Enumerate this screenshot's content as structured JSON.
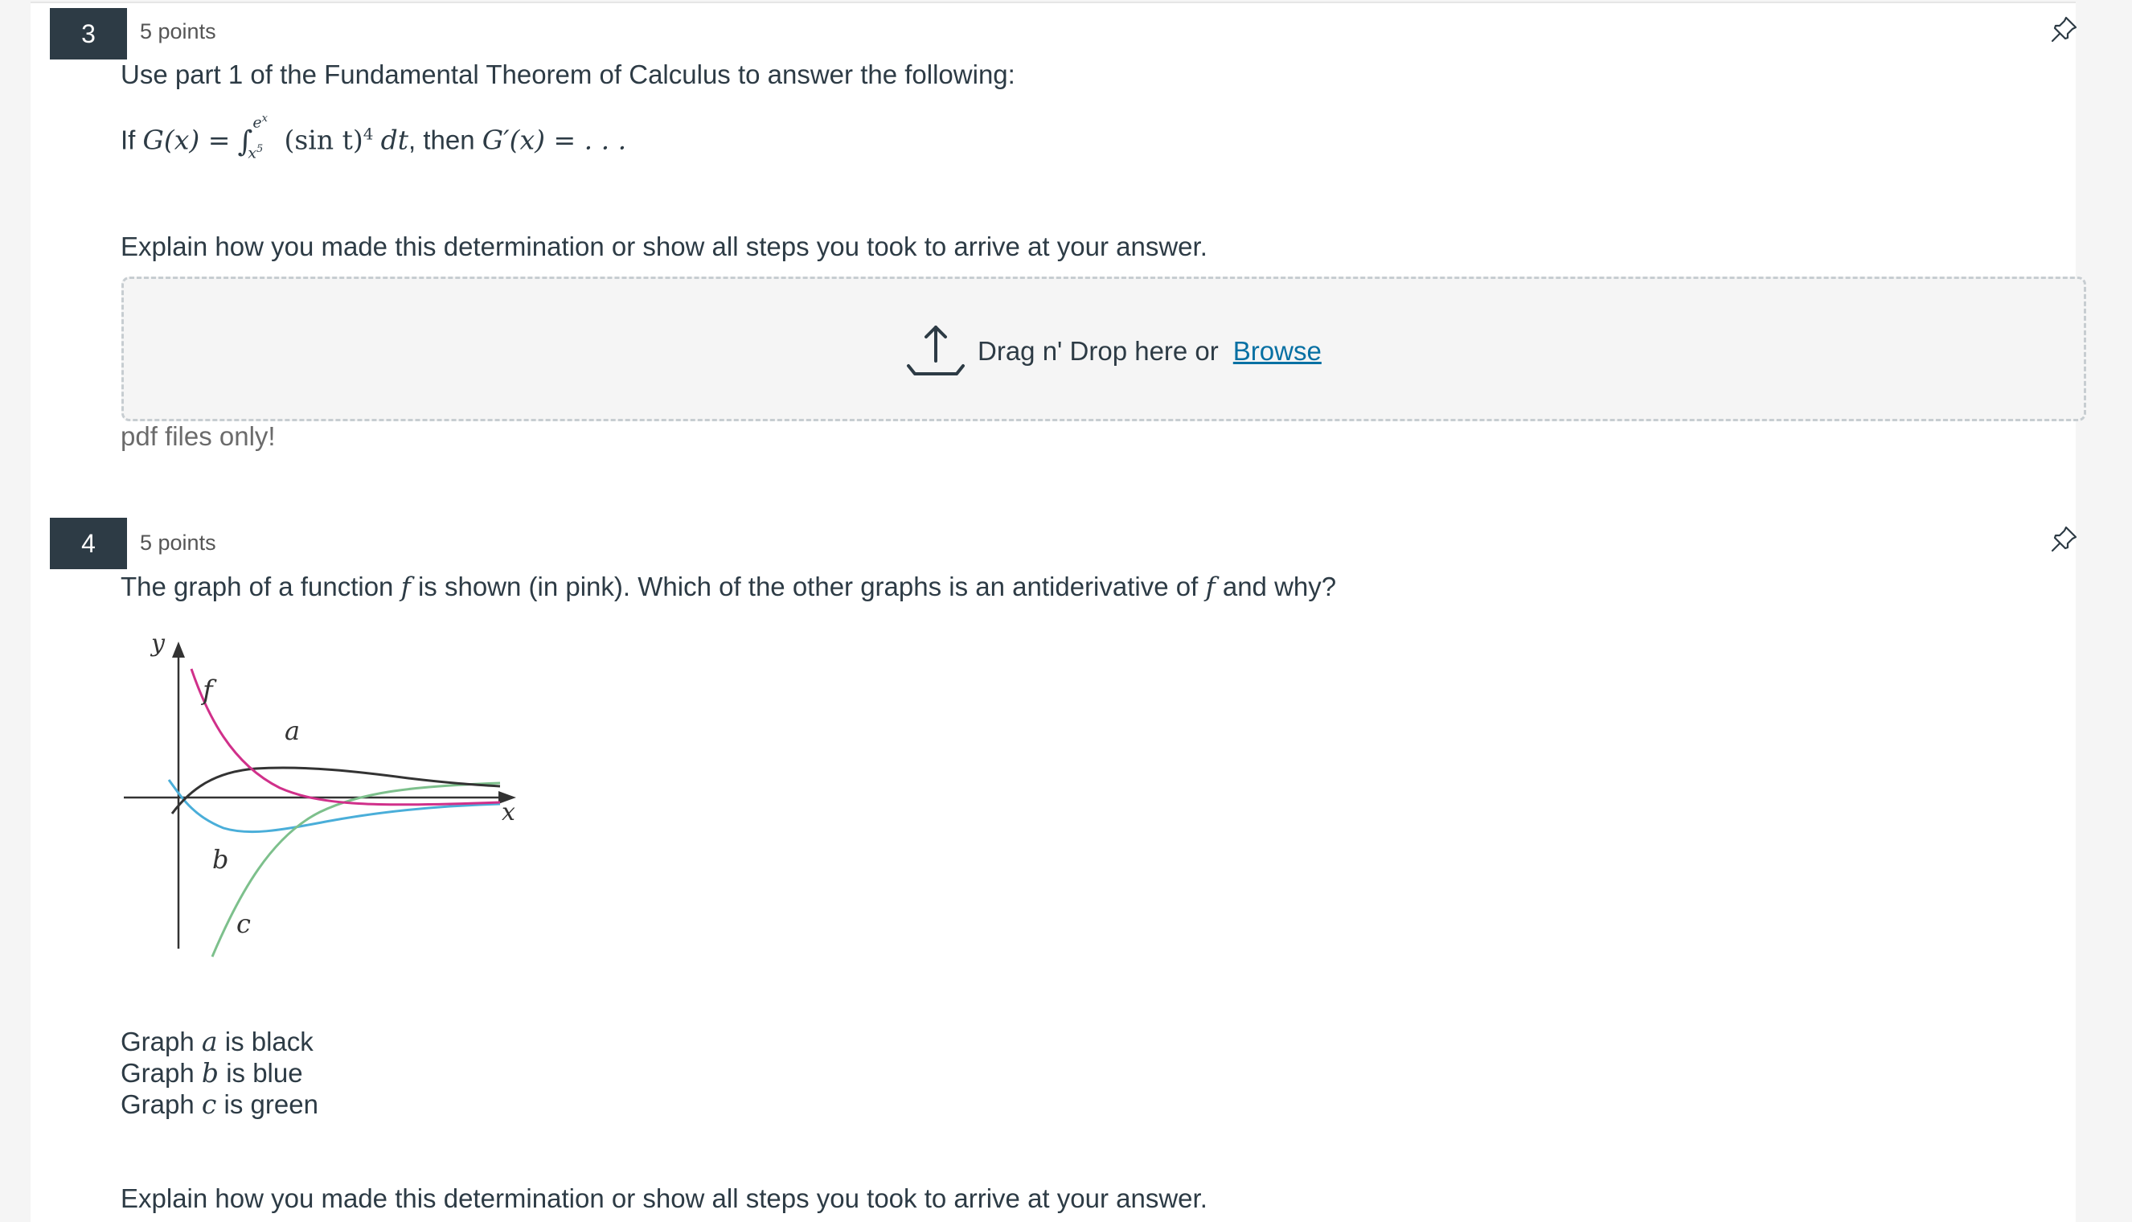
{
  "questions": [
    {
      "number": "3",
      "points": "5 points",
      "prompt": "Use part 1 of the Fundamental Theorem of Calculus to answer the following:",
      "formula": {
        "if": "If",
        "lhs": "G(x) =",
        "upper": "e",
        "upper_sup": "x",
        "lower": "x",
        "lower_sup": "5",
        "integrand": "(sin t)",
        "power": "4",
        "dt": "dt",
        "then": ", then",
        "result": "G′(x) = . . ."
      },
      "explain": "Explain how you made this determination or show all steps you took to arrive at your answer.",
      "upload": {
        "drag_text": "Drag n' Drop here or",
        "browse_label": "Browse",
        "hint": "pdf files only!"
      }
    },
    {
      "number": "4",
      "points": "5 points",
      "prompt_parts": {
        "p1": "The graph of a function",
        "f1": "f",
        "p2": "is shown (in pink). Which of the other graphs is an antiderivative of",
        "f2": "f",
        "p3": "and why?"
      },
      "graph_labels": {
        "y": "y",
        "x": "x",
        "f": "f",
        "a": "a",
        "b": "b",
        "c": "c"
      },
      "legend": [
        {
          "pre": "Graph",
          "var": "a",
          "post": "is black"
        },
        {
          "pre": "Graph",
          "var": "b",
          "post": "is blue"
        },
        {
          "pre": "Graph",
          "var": "c",
          "post": "is green"
        }
      ],
      "explain": "Explain how you made this determination or show all steps you took to arrive at your answer."
    }
  ],
  "colors": {
    "f_curve": "#d0308a",
    "a_curve": "#333333",
    "b_curve": "#4aaed9",
    "c_curve": "#7dc08c",
    "link": "#0770a3",
    "badge": "#2d3b45"
  },
  "icons": {
    "pin": "pin-icon",
    "upload": "upload-icon"
  }
}
